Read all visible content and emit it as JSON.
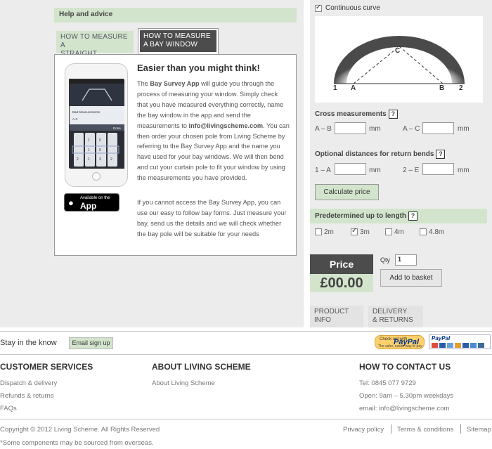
{
  "help": {
    "title": "Help and advice"
  },
  "tabs": [
    {
      "line1": "HOW TO MEASURE A",
      "line2": "STRAIGHT WINDOW"
    },
    {
      "line1": "HOW TO MEASURE",
      "line2": "A BAY WINDOW"
    }
  ],
  "content": {
    "heading": "Easier than you might think!",
    "p1_before": "The ",
    "p1_bold": "Bay Survey App",
    "p1_mid": " will guide you through the process of measuring your window. Simply check that you have measured everything correctly, name the bay window in the app and send the measurements to ",
    "p1_email": "info@livingscheme.com",
    "p1_after": ". You can then order your chosen pole from Living Scheme by referring to the Bay Survey App and the name you have used for your bay windows. We will then bend and cut your curtain pole to fit your window by using the measurements you have provided.",
    "p2": "If you cannot access the Bay Survey App, you can use our easy to follow bay forms. Just measure your bay, send us the details and we will check whether the bay pole will be suitable for your needs",
    "appstore_small": "Available on the",
    "appstore_big": "App Store"
  },
  "phone_screen": {
    "title": "Bad Measurements",
    "row": "A-C",
    "done": "Done",
    "digits": [
      "1",
      "0",
      "1",
      "0",
      "2",
      "1",
      "3",
      "2"
    ]
  },
  "configurator": {
    "continuous_curve": "Continuous curve",
    "continuous_curve_checked": true,
    "diagram_labels": [
      "1",
      "A",
      "B",
      "2",
      "C"
    ],
    "cross_title": "Cross measurements",
    "cross_fields": [
      {
        "label": "A – B",
        "unit": "mm"
      },
      {
        "label": "A – C",
        "unit": "mm"
      }
    ],
    "optional_title": "Optional distances for return bends",
    "optional_fields": [
      {
        "label": "1 – A",
        "unit": "mm"
      },
      {
        "label": "2 – E",
        "unit": "mm"
      }
    ],
    "help_mark": "?",
    "calculate": "Calculate price",
    "predet_title": "Predetermined up to length",
    "lengths": [
      {
        "label": "2m",
        "checked": false
      },
      {
        "label": "3m",
        "checked": true
      },
      {
        "label": "4m",
        "checked": false
      },
      {
        "label": "4.8m",
        "checked": false
      }
    ],
    "price_label": "Price",
    "price_value": "£00.00",
    "qty_label": "Qty",
    "qty_value": "1",
    "add_to_basket": "Add to basket",
    "product_tabs": [
      {
        "line1": "PRODUCT",
        "line2": "INFO"
      },
      {
        "line1": "DELIVERY",
        "line2": "& RETURNS"
      }
    ]
  },
  "newsletter": {
    "stay": "Stay in the know",
    "signup": "Email sign up"
  },
  "paypal": {
    "check_small": "Check out with",
    "check_big": "PayPal",
    "tagline": "The safer, easier way to pay",
    "cards_logo": "PayPal"
  },
  "footer": {
    "customer_services": {
      "heading": "CUSTOMER SERVICES",
      "links": [
        "Dispatch & delivery",
        "Refunds & returns",
        "FAQs"
      ]
    },
    "about": {
      "heading": "ABOUT LIVING SCHEME",
      "links": [
        "About Living Scheme"
      ]
    },
    "contact": {
      "heading": "HOW TO CONTACT US",
      "lines": [
        "Tel: 0845 077 9729",
        "Open: 9am – 5.30pm weekdays",
        "email: info@livingscheme.com"
      ]
    },
    "copyright": "Copyright © 2012 Living Scheme. All Rights Reserved",
    "disclaimer": "*Some components may be sourced from overseas.",
    "bottom_links": [
      "Privacy policy",
      "Terms & conditions",
      "Sitemap"
    ]
  },
  "colors": {
    "accent_green": "#d3e4cd",
    "dark_tab": "#4c4c4c",
    "panel_grey": "#ececec"
  }
}
